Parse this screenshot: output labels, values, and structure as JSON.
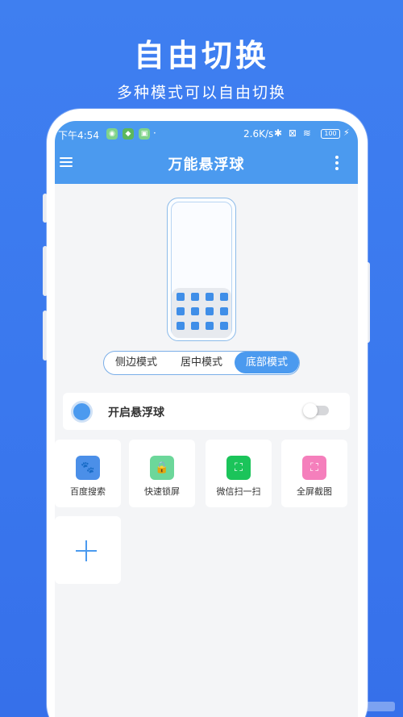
{
  "promo": {
    "title": "自由切换",
    "subtitle": "多种模式可以自由切换"
  },
  "status_bar": {
    "time": "下午4:54",
    "network_speed": "2.6K/s",
    "battery": "100",
    "icons": [
      "app-notification-icon",
      "shield-icon",
      "android-icon",
      "bluetooth-icon",
      "sim-icon",
      "wifi-icon",
      "battery-icon",
      "charging-icon"
    ]
  },
  "app_bar": {
    "title": "万能悬浮球",
    "menu_icon": "menu-icon",
    "more_icon": "more-vertical-icon"
  },
  "mode_selector": {
    "options": [
      "侧边模式",
      "居中模式",
      "底部模式"
    ],
    "selected": "底部模式"
  },
  "float_ball": {
    "label": "开启悬浮球",
    "enabled": false
  },
  "shortcuts": [
    {
      "label": "百度搜索",
      "icon": "paw-icon",
      "color": "#4b8fe8"
    },
    {
      "label": "快速锁屏",
      "icon": "lock-icon",
      "color": "#6cd79a"
    },
    {
      "label": "微信扫一扫",
      "icon": "scan-icon",
      "color": "#1bc45a"
    },
    {
      "label": "全屏截图",
      "icon": "screenshot-icon",
      "color": "#f57fbc"
    }
  ],
  "add_tile": {
    "icon": "plus-icon"
  },
  "colors": {
    "background": "#3f7ff0",
    "app_bar": "#4b9aef",
    "accent": "#4b9aef"
  }
}
